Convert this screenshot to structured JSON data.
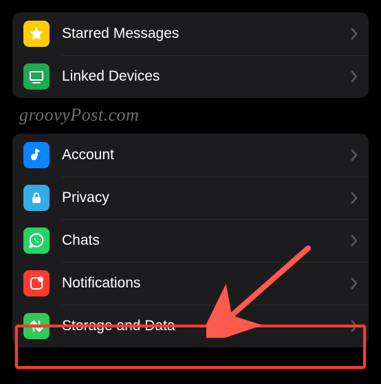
{
  "group1": {
    "items": [
      {
        "label": "Starred Messages",
        "iconColor": "#ffcc00"
      },
      {
        "label": "Linked Devices",
        "iconColor": "#1fa855"
      }
    ]
  },
  "watermark": "groovyPost.com",
  "group2": {
    "items": [
      {
        "label": "Account",
        "iconColor": "#0a84ff"
      },
      {
        "label": "Privacy",
        "iconColor": "#32ade6"
      },
      {
        "label": "Chats",
        "iconColor": "#25d366"
      },
      {
        "label": "Notifications",
        "iconColor": "#ff3b30"
      },
      {
        "label": "Storage and Data",
        "iconColor": "#34c759"
      }
    ]
  },
  "annotation": {
    "highlightColor": "#ff3b30",
    "arrowColor": "#ff5a4d"
  }
}
